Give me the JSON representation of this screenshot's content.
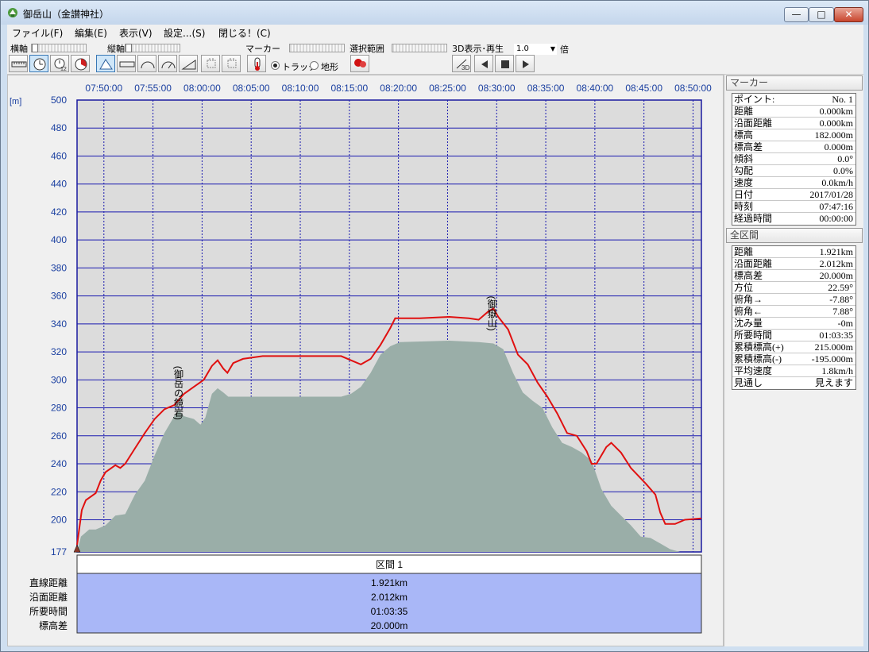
{
  "window": {
    "title": "御岳山（金讃神社）",
    "min_label": "—",
    "max_label": "□",
    "close_label": "✕"
  },
  "menu": [
    {
      "label": "ファイル(F)"
    },
    {
      "label": "編集(E)"
    },
    {
      "label": "表示(V)"
    },
    {
      "label": "設定...(S)"
    },
    {
      "label": "閉じる！(C)"
    }
  ],
  "toolbar": {
    "horizontal_axis_label": "横軸",
    "vertical_axis_label": "縦軸",
    "marker_label": "マーカー",
    "selection_label": "選択範囲",
    "playback_label": "3D表示･再生",
    "speed_value": "1.0",
    "speed_unit": "倍",
    "radio_track_label": "トラック",
    "radio_terrain_label": "地形",
    "btn_3d_label": "3D"
  },
  "chart_data": {
    "type": "area",
    "ylabel": "[m]",
    "x_ticks": [
      "07:50:00",
      "07:55:00",
      "08:00:00",
      "08:05:00",
      "08:10:00",
      "08:15:00",
      "08:20:00",
      "08:25:00",
      "08:30:00",
      "08:35:00",
      "08:40:00",
      "08:45:00",
      "08:50:00"
    ],
    "y_ticks": [
      500,
      480,
      460,
      440,
      420,
      400,
      380,
      360,
      340,
      320,
      300,
      280,
      260,
      240,
      220,
      200
    ],
    "y_bottom_label": "177",
    "xlim": [
      "07:47:16",
      "08:50:51"
    ],
    "ylim": [
      177,
      500
    ],
    "grid": true,
    "series": [
      {
        "color": "#e01010",
        "points": [
          [
            "07:47:16",
            182
          ],
          [
            "07:47:45",
            207
          ],
          [
            "07:48:10",
            214
          ],
          [
            "07:49:10",
            219
          ],
          [
            "07:49:40",
            228
          ],
          [
            "07:50:10",
            234
          ],
          [
            "07:51:10",
            239
          ],
          [
            "07:51:40",
            237
          ],
          [
            "07:52:10",
            240
          ],
          [
            "07:53:10",
            251
          ],
          [
            "07:54:10",
            262
          ],
          [
            "07:55:10",
            272
          ],
          [
            "07:56:10",
            279
          ],
          [
            "07:57:10",
            282
          ],
          [
            "07:58:10",
            290
          ],
          [
            "07:59:10",
            295
          ],
          [
            "08:00:10",
            300
          ],
          [
            "08:01:00",
            310
          ],
          [
            "08:01:35",
            314
          ],
          [
            "08:02:10",
            308
          ],
          [
            "08:02:35",
            305
          ],
          [
            "08:03:10",
            312
          ],
          [
            "08:04:10",
            315
          ],
          [
            "08:05:10",
            316
          ],
          [
            "08:06:10",
            317
          ],
          [
            "08:10:10",
            317
          ],
          [
            "08:14:10",
            317
          ],
          [
            "08:15:10",
            314
          ],
          [
            "08:16:10",
            311
          ],
          [
            "08:17:10",
            315
          ],
          [
            "08:18:10",
            325
          ],
          [
            "08:19:10",
            337
          ],
          [
            "08:19:40",
            344
          ],
          [
            "08:22:10",
            344
          ],
          [
            "08:25:10",
            345
          ],
          [
            "08:27:10",
            344
          ],
          [
            "08:28:10",
            343
          ],
          [
            "08:29:10",
            349
          ],
          [
            "08:29:40",
            351
          ],
          [
            "08:30:10",
            345
          ],
          [
            "08:31:10",
            336
          ],
          [
            "08:32:10",
            318
          ],
          [
            "08:33:10",
            311
          ],
          [
            "08:34:10",
            298
          ],
          [
            "08:35:10",
            288
          ],
          [
            "08:36:10",
            276
          ],
          [
            "08:37:10",
            262
          ],
          [
            "08:38:10",
            260
          ],
          [
            "08:39:10",
            249
          ],
          [
            "08:39:40",
            240
          ],
          [
            "08:40:10",
            240
          ],
          [
            "08:41:10",
            252
          ],
          [
            "08:41:40",
            255
          ],
          [
            "08:42:40",
            248
          ],
          [
            "08:43:40",
            237
          ],
          [
            "08:45:10",
            226
          ],
          [
            "08:46:10",
            218
          ],
          [
            "08:46:40",
            205
          ],
          [
            "08:47:10",
            197
          ],
          [
            "08:48:10",
            197
          ],
          [
            "08:49:10",
            200
          ],
          [
            "08:50:51",
            201
          ]
        ]
      },
      {
        "color": "#9aaea8",
        "points": [
          [
            "07:47:16",
            177
          ],
          [
            "07:47:40",
            188
          ],
          [
            "07:48:30",
            193
          ],
          [
            "07:49:10",
            193
          ],
          [
            "07:50:10",
            196
          ],
          [
            "07:51:10",
            203
          ],
          [
            "07:52:10",
            204
          ],
          [
            "07:53:10",
            218
          ],
          [
            "07:54:10",
            228
          ],
          [
            "07:55:10",
            246
          ],
          [
            "07:56:10",
            262
          ],
          [
            "07:57:10",
            274
          ],
          [
            "07:57:40",
            278
          ],
          [
            "07:58:10",
            274
          ],
          [
            "07:59:10",
            272
          ],
          [
            "07:59:50",
            268
          ],
          [
            "08:00:20",
            273
          ],
          [
            "08:01:00",
            290
          ],
          [
            "08:01:35",
            294
          ],
          [
            "08:02:10",
            291
          ],
          [
            "08:02:40",
            288
          ],
          [
            "08:10:10",
            288
          ],
          [
            "08:14:10",
            288
          ],
          [
            "08:15:10",
            290
          ],
          [
            "08:16:10",
            295
          ],
          [
            "08:17:10",
            305
          ],
          [
            "08:18:10",
            318
          ],
          [
            "08:19:10",
            324
          ],
          [
            "08:20:10",
            327
          ],
          [
            "08:25:10",
            328
          ],
          [
            "08:28:10",
            327
          ],
          [
            "08:29:40",
            326
          ],
          [
            "08:30:40",
            322
          ],
          [
            "08:31:40",
            305
          ],
          [
            "08:32:40",
            291
          ],
          [
            "08:33:40",
            285
          ],
          [
            "08:34:40",
            280
          ],
          [
            "08:35:40",
            266
          ],
          [
            "08:36:40",
            255
          ],
          [
            "08:37:40",
            252
          ],
          [
            "08:38:40",
            248
          ],
          [
            "08:39:40",
            242
          ],
          [
            "08:40:40",
            222
          ],
          [
            "08:41:40",
            210
          ],
          [
            "08:42:40",
            203
          ],
          [
            "08:43:40",
            196
          ],
          [
            "08:44:40",
            188
          ],
          [
            "08:45:40",
            187
          ],
          [
            "08:46:40",
            183
          ],
          [
            "08:47:40",
            179
          ],
          [
            "08:48:40",
            177
          ],
          [
            "08:50:51",
            177
          ]
        ]
      }
    ],
    "annotations": [
      {
        "text": "(御岳の鏡岩)",
        "at": [
          "07:57:35",
          310
        ]
      },
      {
        "text": "(御嶽山)",
        "at": [
          "08:29:30",
          360
        ]
      }
    ]
  },
  "segment_table": {
    "header": "区間 1",
    "rows": [
      {
        "label": "直線距離",
        "value": "1.921km"
      },
      {
        "label": "沿面距離",
        "value": "2.012km"
      },
      {
        "label": "所要時間",
        "value": "01:03:35"
      },
      {
        "label": "標高差",
        "value": "20.000m"
      }
    ]
  },
  "marker_panel": {
    "title": "マーカー",
    "rows": [
      {
        "k": "ポイント:",
        "v": "No. 1"
      },
      {
        "k": "距離",
        "v": "0.000km"
      },
      {
        "k": "沿面距離",
        "v": "0.000km"
      },
      {
        "k": "標高",
        "v": "182.000m"
      },
      {
        "k": "標高差",
        "v": "0.000m"
      },
      {
        "k": "傾斜",
        "v": "0.0°"
      },
      {
        "k": "勾配",
        "v": "0.0%"
      },
      {
        "k": "速度",
        "v": "0.0km/h"
      },
      {
        "k": "日付",
        "v": "2017/01/28"
      },
      {
        "k": "時刻",
        "v": "07:47:16"
      },
      {
        "k": "経過時間",
        "v": "00:00:00"
      }
    ]
  },
  "total_panel": {
    "title": "全区間",
    "rows": [
      {
        "k": "距離",
        "v": "1.921km"
      },
      {
        "k": "沿面距離",
        "v": "2.012km"
      },
      {
        "k": "標高差",
        "v": "20.000m"
      },
      {
        "k": "方位",
        "v": "22.59°"
      },
      {
        "k": "俯角→",
        "v": "-7.88°"
      },
      {
        "k": "俯角←",
        "v": "7.88°"
      },
      {
        "k": "沈み量",
        "v": "-0m"
      },
      {
        "k": "所要時間",
        "v": "01:03:35"
      },
      {
        "k": "累積標高(+)",
        "v": "215.000m"
      },
      {
        "k": "累積標高(-)",
        "v": "-195.000m"
      },
      {
        "k": "平均速度",
        "v": "1.8km/h"
      },
      {
        "k": "見通し",
        "v": "見えます"
      }
    ]
  }
}
